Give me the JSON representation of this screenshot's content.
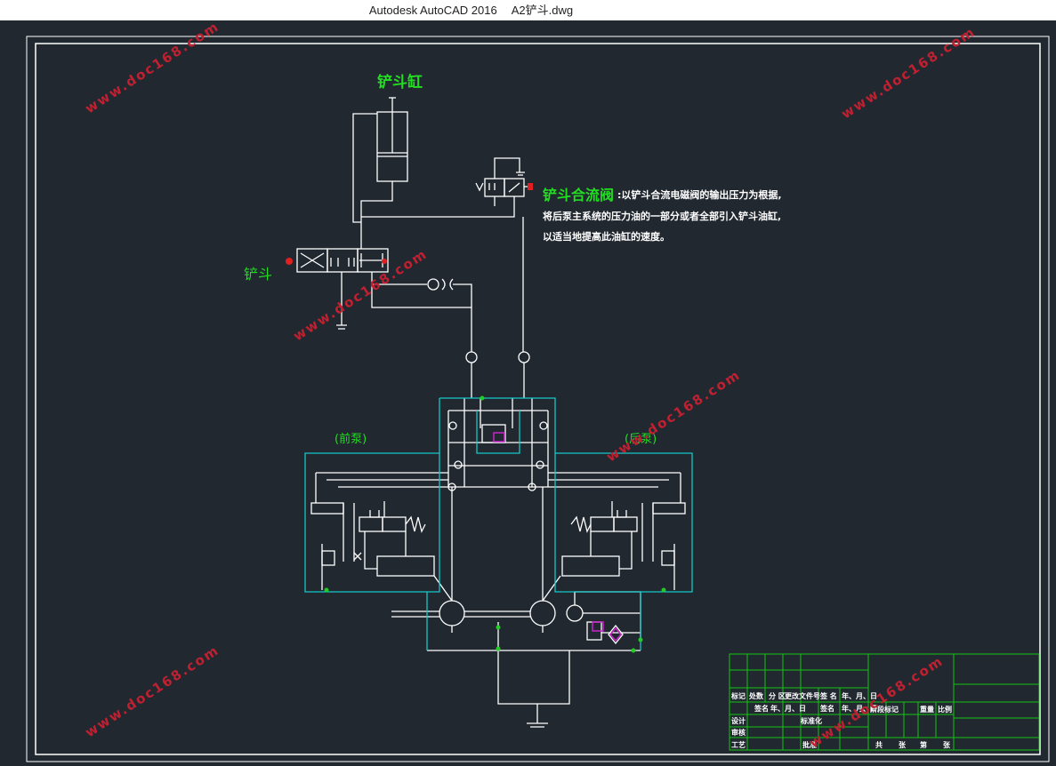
{
  "window": {
    "app_title": "Autodesk AutoCAD 2016",
    "file_name": "A2铲斗.dwg"
  },
  "diagram": {
    "cylinder_label": "铲斗缸",
    "control_valve_label": "铲斗",
    "merge_valve_title": "铲斗合流阀",
    "merge_valve_desc_line1": ":以铲斗合流电磁阀的输出压力为根据,",
    "merge_valve_desc_line2": "将后泵主系统的压力油的一部分或者全部引入铲斗油缸,",
    "merge_valve_desc_line3": "以适当地提高此油缸的速度。",
    "front_pump_label": "(前泵)",
    "rear_pump_label": "(后泵)"
  },
  "watermark": "www.doc168.com",
  "title_block": {
    "row1": [
      "标记",
      "处数",
      "分 区",
      "更改文件号",
      "签 名",
      "年、月、日"
    ],
    "row1b": [
      "阶段标记",
      "重量",
      "比例"
    ],
    "row2": [
      "签名",
      "年、月、日",
      "签名",
      "年、月、日"
    ],
    "design": "设计",
    "standardize": "标准化",
    "review": "审核",
    "process": "工艺",
    "approve": "批准",
    "total": "共",
    "sheet": "张",
    "page": "第",
    "page2": "张"
  },
  "colors": {
    "background": "#212830",
    "line": "#ffffff",
    "green_text": "#22dd22",
    "cyan_frame": "#14c8c8",
    "title_block": "#12c412",
    "watermark": "#c02030",
    "magenta": "#cc22cc"
  }
}
